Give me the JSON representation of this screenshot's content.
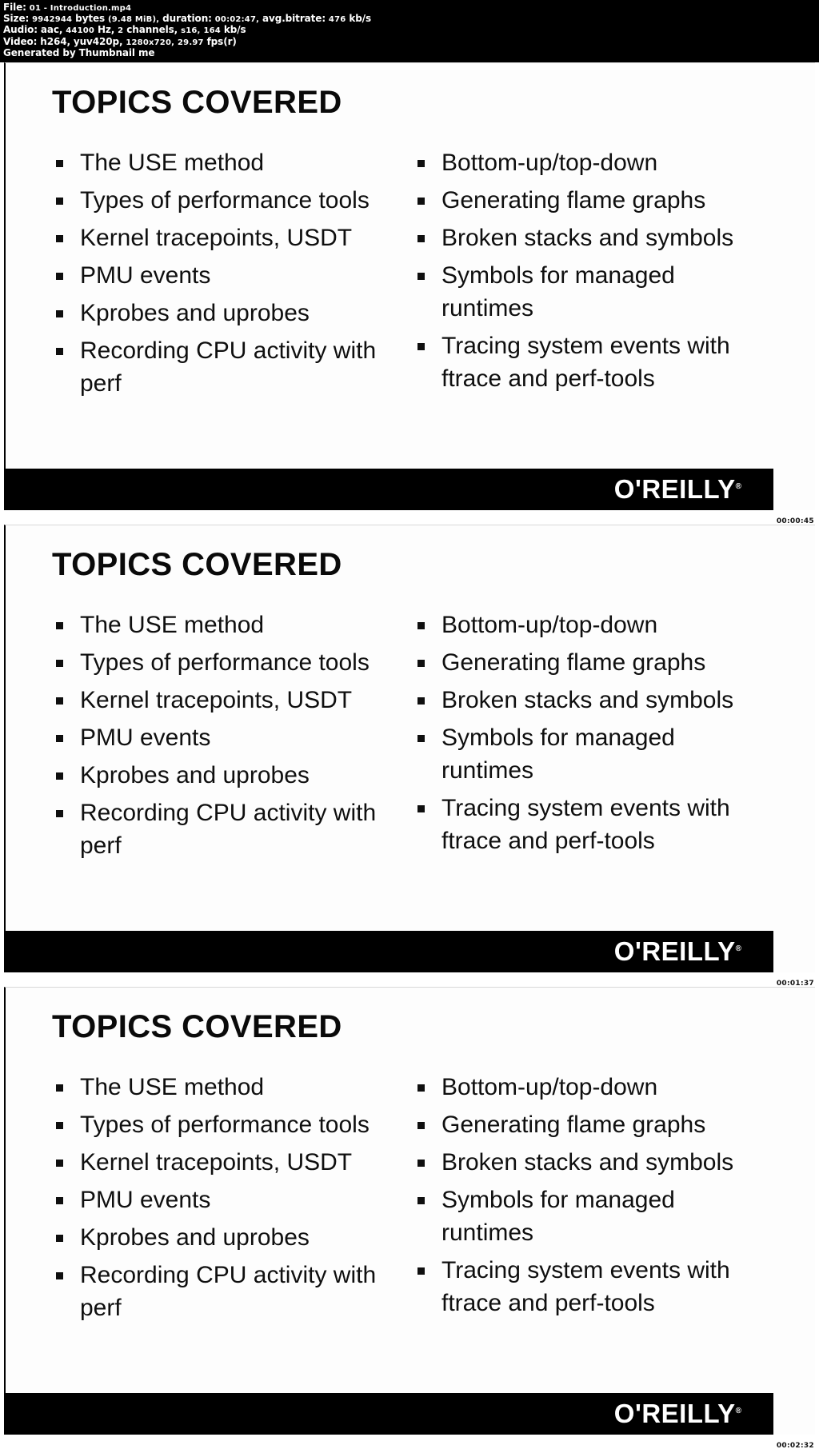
{
  "metadata": {
    "file_label": "File:",
    "file_name": "01 - Introduction.mp4",
    "size_label": "Size:",
    "size_bytes": "9942944",
    "size_bytes_unit": "bytes",
    "size_human": "(9.48 MiB),",
    "duration_label": "duration:",
    "duration_value": "00:02:47,",
    "bitrate_label": "avg.bitrate:",
    "bitrate_value": "476",
    "bitrate_unit": "kb/s",
    "audio_label": "Audio:",
    "audio_codec": "aac,",
    "audio_rate": "44100",
    "audio_rate_unit": "Hz,",
    "audio_channels_num": "2",
    "audio_channels": "channels,",
    "audio_format": "s16,",
    "audio_bitrate": "164",
    "audio_bitrate_unit": "kb/s",
    "video_label": "Video:",
    "video_codec": "h264,",
    "video_pixfmt": "yuv420p,",
    "video_resolution": "1280x720,",
    "video_fps": "29.97",
    "video_fps_unit": "fps(r)",
    "generator": "Generated by Thumbnail me"
  },
  "slide": {
    "title": "TOPICS COVERED",
    "left_bullets": [
      "The USE method",
      "Types of performance tools",
      "Kernel tracepoints, USDT",
      "PMU events",
      "Kprobes and uprobes",
      "Recording CPU activity with perf"
    ],
    "right_bullets": [
      "Bottom-up/top-down",
      "Generating flame graphs",
      "Broken stacks and symbols",
      "Symbols for managed runtimes",
      "Tracing system events with ftrace and perf-tools"
    ],
    "brand": "O'REILLY",
    "brand_tm": "®"
  },
  "frames": [
    {
      "timestamp": "00:00:45"
    },
    {
      "timestamp": "00:01:37"
    },
    {
      "timestamp": "00:02:32"
    }
  ],
  "colors": {
    "background": "#ffffff",
    "header_bg": "#000000",
    "header_fg": "#ffffff",
    "slide_bg": "#fdfdfd",
    "text": "#0f0f0f",
    "brand_bar": "#000000"
  }
}
